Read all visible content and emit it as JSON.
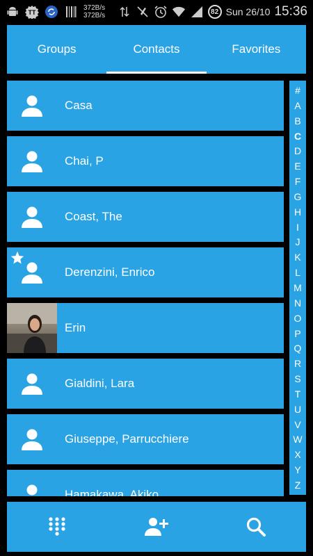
{
  "status_bar": {
    "speed_up": "372B/s",
    "speed_down": "372B/s",
    "battery": "82",
    "date": "Sun 26/10",
    "time": "15:36",
    "icons": [
      "android-icon",
      "app-t-icon",
      "sync-icon",
      "barcode-icon",
      "data-transfer-icon",
      "mute-icon",
      "alarm-icon",
      "wifi-icon",
      "signal-icon"
    ]
  },
  "tabs": [
    {
      "label": "Groups",
      "active": false
    },
    {
      "label": "Contacts",
      "active": true
    },
    {
      "label": "Favorites",
      "active": false
    }
  ],
  "contacts": [
    {
      "name": "Casa",
      "favorite": false,
      "photo": false
    },
    {
      "name": "Chai, P",
      "favorite": false,
      "photo": false
    },
    {
      "name": "Coast, The",
      "favorite": false,
      "photo": false
    },
    {
      "name": "Derenzini, Enrico",
      "favorite": true,
      "photo": false
    },
    {
      "name": "Erin",
      "favorite": false,
      "photo": true
    },
    {
      "name": "Gialdini, Lara",
      "favorite": false,
      "photo": false
    },
    {
      "name": "Giuseppe, Parrucchiere",
      "favorite": false,
      "photo": false
    },
    {
      "name": "Hamakawa, Akiko",
      "favorite": false,
      "photo": false
    }
  ],
  "alphabet": [
    "#",
    "A",
    "B",
    "C",
    "D",
    "E",
    "F",
    "G",
    "H",
    "I",
    "J",
    "K",
    "L",
    "M",
    "N",
    "O",
    "P",
    "Q",
    "R",
    "S",
    "T",
    "U",
    "V",
    "W",
    "X",
    "Y",
    "Z"
  ],
  "alphabet_current": "C",
  "bottom_bar": {
    "icons": [
      "dialpad-icon",
      "add-contact-icon",
      "search-icon"
    ]
  },
  "colors": {
    "accent": "#29a3e4",
    "background": "#000000",
    "text": "#ffffff"
  }
}
